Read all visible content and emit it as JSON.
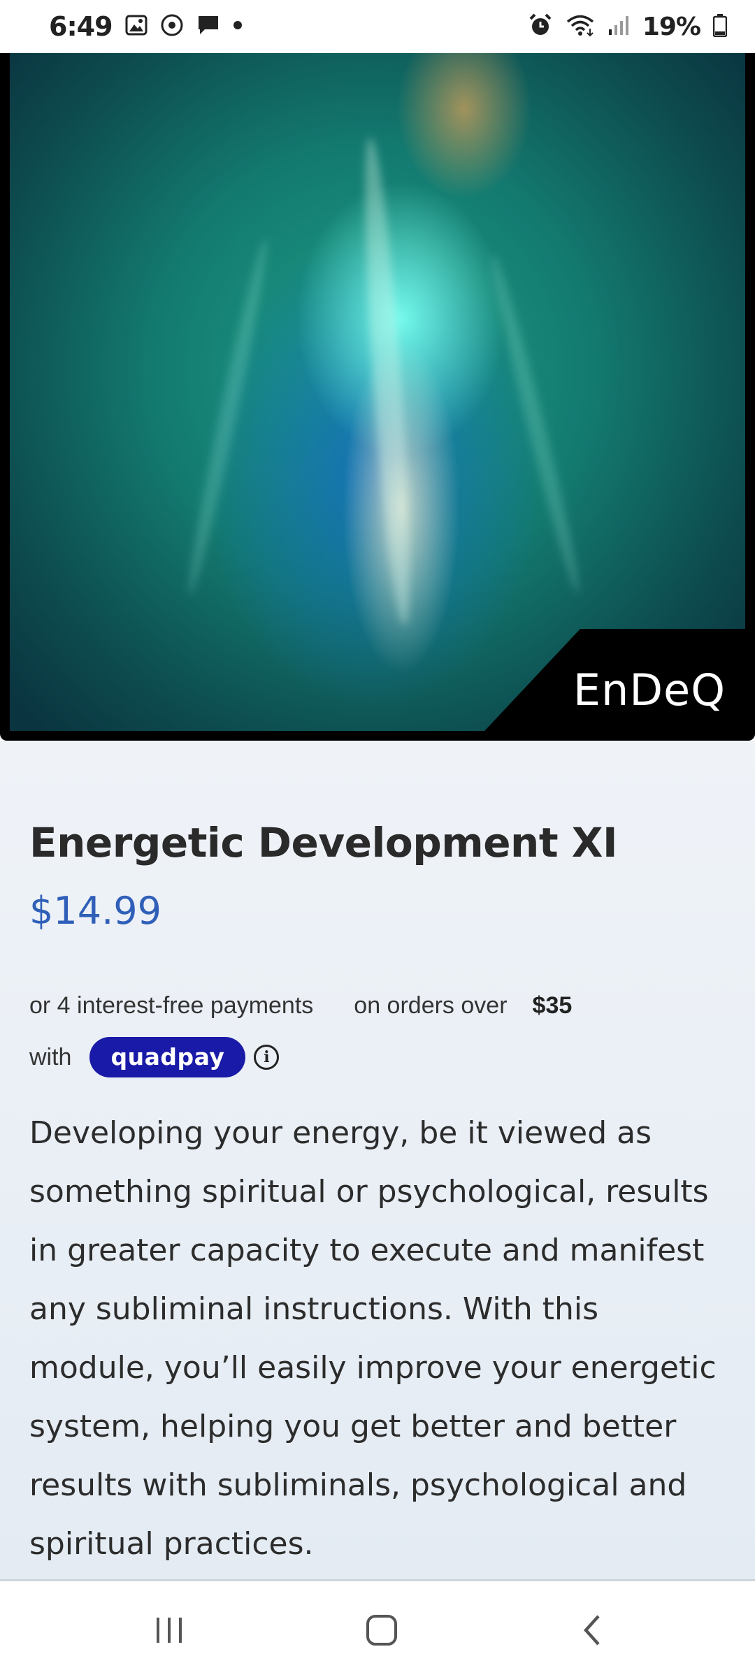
{
  "status_bar": {
    "time": "6:49",
    "battery_percent": "19%",
    "icons": [
      "image-icon",
      "circle-dot-icon",
      "message-icon",
      "dot-icon",
      "alarm-icon",
      "wifi-icon",
      "signal-icon",
      "battery-icon"
    ]
  },
  "product": {
    "image_brand": "EnDeQ",
    "title": "Energetic Development XI",
    "price": "$14.99",
    "payment": {
      "line1": "or 4 interest-free payments",
      "line1_orders": "on orders over",
      "threshold": "$35",
      "with_label": "with",
      "provider": "quadpay",
      "info_glyph": "i"
    },
    "description": "Developing your energy, be it viewed as something spiritual or psychological, results in greater capacity to execute and manifest any subliminal instructions. With this module, you’ll easily improve your energetic system, helping you get better and better results with subliminals, psychological and spiritual practices."
  },
  "nav": {
    "items": [
      "recents-icon",
      "home-icon",
      "back-icon"
    ]
  },
  "colors": {
    "price": "#2f5fb8",
    "quadpay_badge": "#1a1aa8",
    "content_bg": "#eff3f8"
  }
}
